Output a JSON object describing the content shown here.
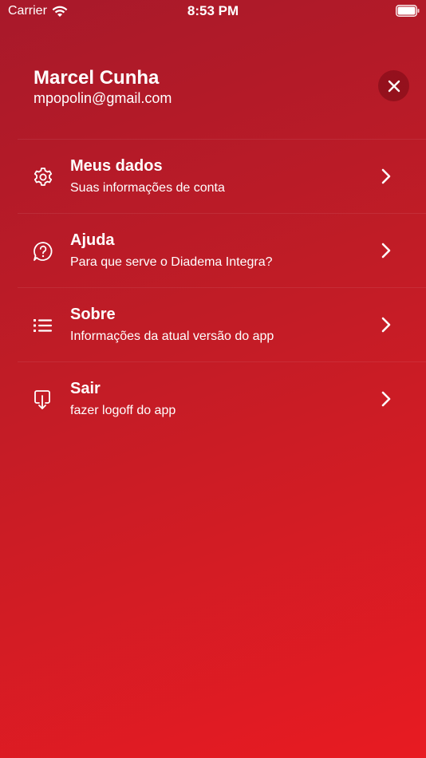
{
  "status_bar": {
    "carrier": "Carrier",
    "time": "8:53 PM"
  },
  "header": {
    "name": "Marcel Cunha",
    "email": "mpopolin@gmail.com"
  },
  "menu": {
    "items": [
      {
        "icon": "gear-icon",
        "title": "Meus dados",
        "subtitle": "Suas informações de conta"
      },
      {
        "icon": "help-bubble-icon",
        "title": "Ajuda",
        "subtitle": "Para que serve o Diadema Integra?"
      },
      {
        "icon": "list-icon",
        "title": "Sobre",
        "subtitle": "Informações da atual versão do app"
      },
      {
        "icon": "logout-icon",
        "title": "Sair",
        "subtitle": "fazer logoff do app"
      }
    ]
  },
  "colors": {
    "gradient_start": "#a8192a",
    "gradient_end": "#e81b22",
    "text": "#ffffff",
    "close_bg": "#7a0a14"
  }
}
